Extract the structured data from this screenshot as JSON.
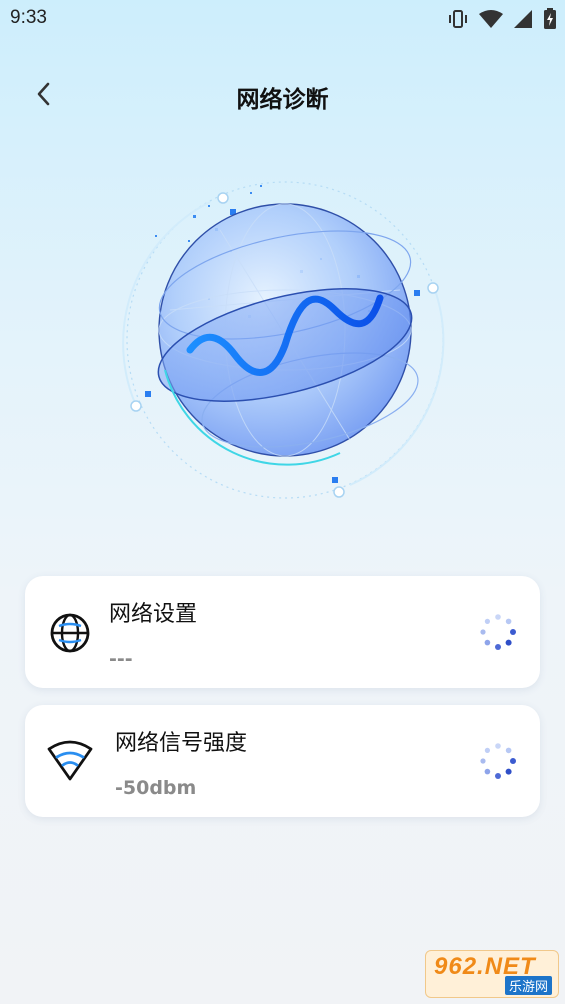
{
  "status_bar": {
    "time": "9:33",
    "icons": [
      "vibrate-icon",
      "wifi-signal-icon",
      "cellular-signal-icon",
      "battery-charging-icon"
    ]
  },
  "header": {
    "back_icon": "chevron-left-icon",
    "title": "网络诊断"
  },
  "hero": {
    "image": "globe-network-illustration"
  },
  "cards": [
    {
      "icon": "globe-icon",
      "title": "网络设置",
      "value": "---",
      "status": "loading-spinner"
    },
    {
      "icon": "wifi-icon",
      "title": "网络信号强度",
      "value": "-50dbm",
      "status": "loading-spinner"
    }
  ],
  "watermark": {
    "top": "962.NET",
    "bottom": "乐游网"
  },
  "colors": {
    "accent": "#1e63f0",
    "card_bg": "#ffffff",
    "value_text": "#8a8a8a"
  }
}
